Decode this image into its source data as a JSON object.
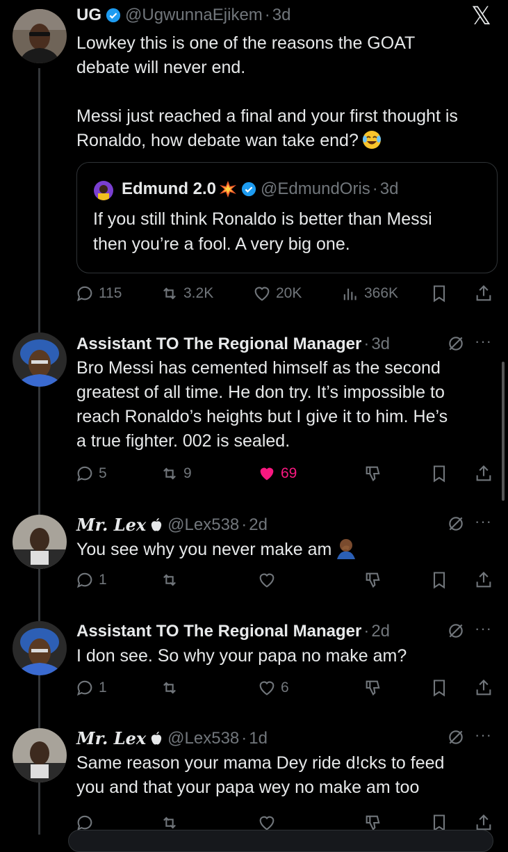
{
  "top_tweet": {
    "name": "UG",
    "handle": "@UgwunnaEjikem",
    "time": "3d",
    "body_line1": "Lowkey this is one of the reasons the GOAT",
    "body_line2": "debate will never end.",
    "body_line3": "Messi just reached a final and your first thought is",
    "body_line4": "Ronaldo, how debate wan take end?",
    "quote": {
      "name": "Edmund 2.0",
      "handle": "@EdmundOris",
      "time": "3d",
      "line1": "If you still think Ronaldo is better than Messi",
      "line2": "then you’re a fool. A very big one."
    },
    "replies": "115",
    "reposts": "3.2K",
    "likes": "20K",
    "views": "366K"
  },
  "replies": [
    {
      "name": "Assistant TO The Regional Manager",
      "time": "3d",
      "lines": [
        "Bro Messi has cemented himself as the second",
        "greatest of all time. He don try. It’s impossible to",
        "reach Ronaldo’s heights but I give it to him. He’s",
        "a true fighter. 002 is sealed."
      ],
      "replies": "5",
      "reposts": "9",
      "likes": "69"
    },
    {
      "name": "Mr. Lex",
      "handle": "@Lex538",
      "time": "2d",
      "lines": [
        "You see why you never make am"
      ],
      "replies": "1",
      "reposts": "",
      "likes": ""
    },
    {
      "name": "Assistant TO The Regional Manager",
      "time": "2d",
      "lines": [
        "I don see. So why your papa no make am?"
      ],
      "replies": "1",
      "reposts": "",
      "likes": "6"
    },
    {
      "name": "Mr. Lex",
      "handle": "@Lex538",
      "time": "1d",
      "lines": [
        "Same reason your mama Dey ride d!cks to feed",
        "you and that your papa wey no make am too"
      ]
    }
  ],
  "dot": "·",
  "more": "···",
  "x_logo": "𝕏",
  "colors": {
    "like_active": "#f91880",
    "verified": "#1d9bf0",
    "muted": "#71767b"
  }
}
